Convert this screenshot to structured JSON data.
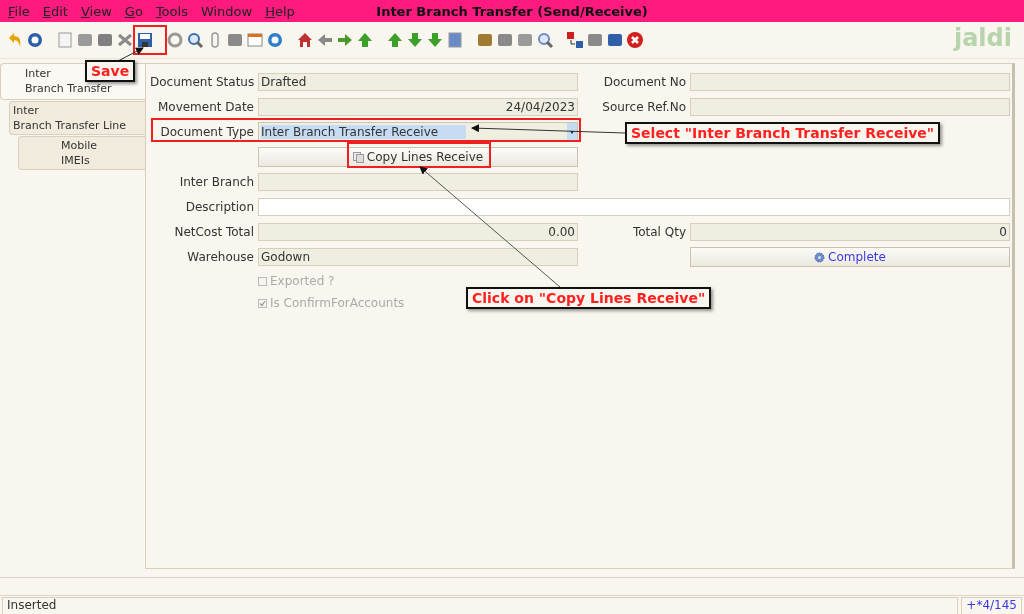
{
  "window": {
    "title": "Inter Branch Transfer (Send/Receive)"
  },
  "menu": [
    {
      "label": "File",
      "underlined": true
    },
    {
      "label": "Edit",
      "underlined": true
    },
    {
      "label": "View",
      "underlined": true
    },
    {
      "label": "Go",
      "underlined": true
    },
    {
      "label": "Tools",
      "underlined": true
    },
    {
      "label": "Window",
      "underlined": false
    },
    {
      "label": "Help",
      "underlined": true
    }
  ],
  "logo": "jaldi",
  "tabs": [
    {
      "label": "Inter\nBranch Transfer",
      "selected": true,
      "children": [
        {
          "label": "Inter\nBranch Transfer Line",
          "selected": false,
          "children": [
            {
              "label": "Mobile\nIMEIs",
              "selected": false
            }
          ]
        }
      ]
    }
  ],
  "form": [
    {
      "left": {
        "label": "Document Status",
        "kind": "text",
        "value": "Drafted",
        "readonly": true
      },
      "right": {
        "label": "Document No",
        "kind": "text",
        "readonly": true
      }
    },
    {
      "left": {
        "label": "Movement Date",
        "kind": "number",
        "value": "24/04/2023",
        "readonly": true
      },
      "right": {
        "label": "Source Ref.No",
        "kind": "text",
        "readonly": true
      }
    },
    {
      "left": {
        "label": "Document Type",
        "kind": "combo",
        "value": "Inter Branch Transfer Receive",
        "highlighted": true
      }
    },
    {
      "left": {
        "kind": "button",
        "value": "Copy Lines Receive"
      }
    },
    {
      "left": {
        "label": "Inter Branch",
        "kind": "text",
        "readonly": true
      }
    },
    {
      "full": {
        "label": "Description",
        "kind": "text",
        "readonly": false
      }
    },
    {
      "left": {
        "label": "NetCost Total",
        "kind": "number",
        "value": "0.00",
        "readonly": true
      },
      "right": {
        "label": "Total Qty",
        "kind": "number",
        "value": "0",
        "readonly": true
      }
    },
    {
      "left": {
        "label": "Warehouse",
        "kind": "text",
        "value": "Godown",
        "readonly": true
      },
      "right": {
        "kind": "process-button",
        "value": "Complete"
      }
    },
    {
      "left": {
        "kind": "checkbox",
        "value": "Exported ?",
        "checked": false,
        "disabled": true
      }
    },
    {
      "left": {
        "kind": "checkbox",
        "value": "Is ConfirmForAccounts",
        "checked": true,
        "disabled": true
      }
    }
  ],
  "annotations": [
    {
      "text": "Save"
    },
    {
      "text": "Select \"Inter Branch Transfer Receive\""
    },
    {
      "text": "Click on \"Copy Lines Receive\""
    }
  ],
  "status_bar": {
    "message": "Inserted",
    "record": "+*4/145"
  }
}
